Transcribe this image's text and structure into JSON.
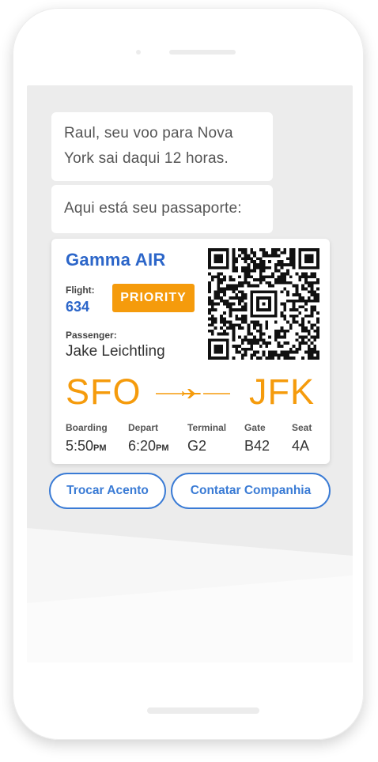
{
  "messages": [
    {
      "text": "Raul, seu voo para Nova York sai daqui 12 horas."
    },
    {
      "text": "Aqui está seu passaporte:"
    }
  ],
  "boarding_pass": {
    "airline": "Gamma AIR",
    "flight_label": "Flight:",
    "flight_number": "634",
    "priority": "PRIORITY",
    "passenger_label": "Passenger:",
    "passenger_name": "Jake Leichtling",
    "origin": "SFO",
    "destination": "JFK",
    "details": {
      "boarding_label": "Boarding",
      "boarding_time": "5:50",
      "boarding_ampm": "PM",
      "depart_label": "Depart",
      "depart_time": "6:20",
      "depart_ampm": "PM",
      "terminal_label": "Terminal",
      "terminal": "G2",
      "gate_label": "Gate",
      "gate": "B42",
      "seat_label": "Seat",
      "seat": "4A"
    }
  },
  "actions": {
    "change_seat": "Trocar Acento",
    "contact_airline": "Contatar Companhia"
  },
  "colors": {
    "brand_blue": "#2c66c9",
    "accent_orange": "#f59b0c",
    "button_blue": "#3a7bd5"
  }
}
